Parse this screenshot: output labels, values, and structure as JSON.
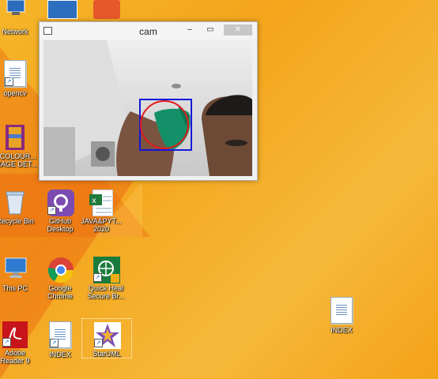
{
  "desktop": {
    "icons": [
      {
        "name": "network",
        "label": "Network"
      },
      {
        "name": "opencv",
        "label": "opencv"
      },
      {
        "name": "colour",
        "label": "...COLOUR...\nIMAGE DET..."
      },
      {
        "name": "recycle-bin",
        "label": "Recycle Bin"
      },
      {
        "name": "github",
        "label": "GitHub\nDesktop"
      },
      {
        "name": "java-python",
        "label": "JAVA&PYT...\n2020"
      },
      {
        "name": "this-pc",
        "label": "This PC"
      },
      {
        "name": "chrome",
        "label": "Google\nChrome"
      },
      {
        "name": "quick-heal",
        "label": "Quick Heal\nSecure Br..."
      },
      {
        "name": "adobe-reader",
        "label": "Adobe\nReader 9"
      },
      {
        "name": "index-left",
        "label": "INDEX"
      },
      {
        "name": "staruml",
        "label": "StarUML"
      },
      {
        "name": "index-right",
        "label": "INDEX"
      }
    ]
  },
  "window": {
    "title": "cam",
    "minimize": "–",
    "maximize": "▭",
    "close": "✕"
  }
}
